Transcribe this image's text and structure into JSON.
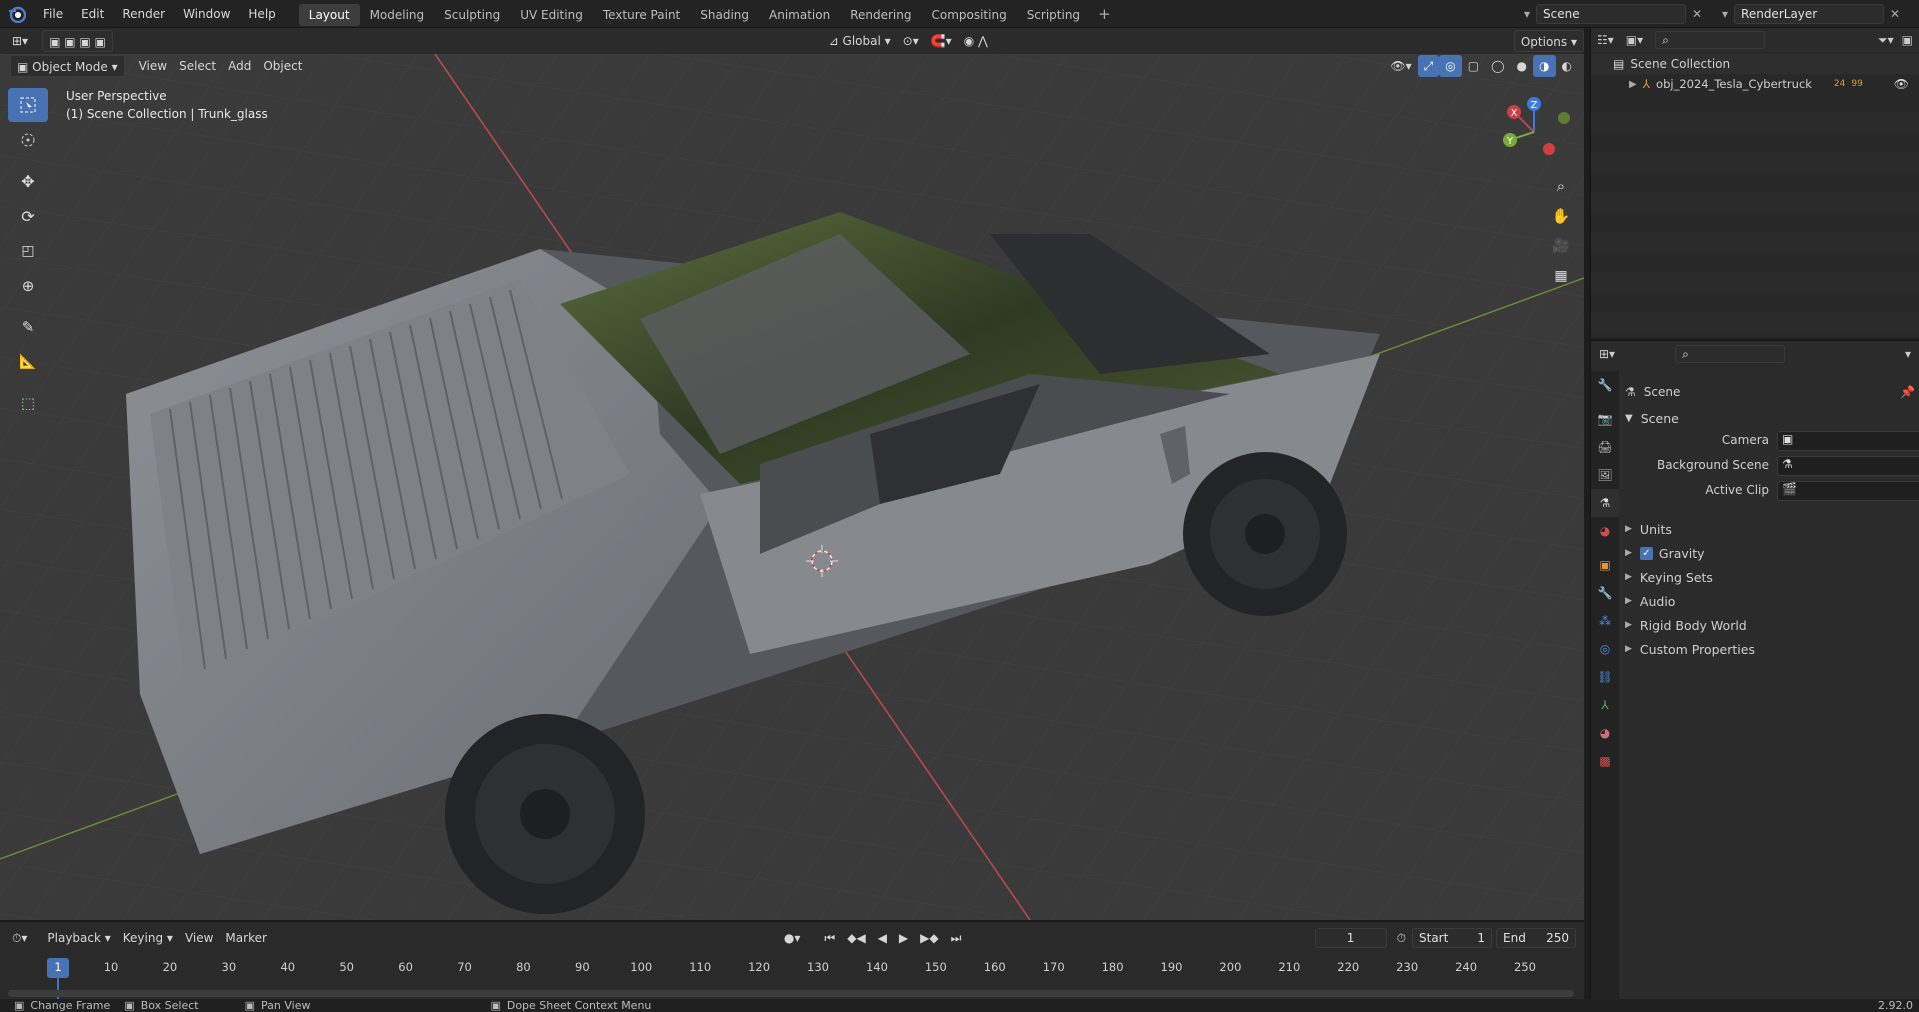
{
  "top_menu": [
    "File",
    "Edit",
    "Render",
    "Window",
    "Help"
  ],
  "workspaces": [
    {
      "label": "Layout",
      "active": true
    },
    {
      "label": "Modeling"
    },
    {
      "label": "Sculpting"
    },
    {
      "label": "UV Editing"
    },
    {
      "label": "Texture Paint"
    },
    {
      "label": "Shading"
    },
    {
      "label": "Animation"
    },
    {
      "label": "Rendering"
    },
    {
      "label": "Compositing"
    },
    {
      "label": "Scripting"
    }
  ],
  "scene_field": "Scene",
  "renderlayer_field": "RenderLayer",
  "vp_header": {
    "mode": "Object Mode",
    "menus": [
      "View",
      "Select",
      "Add",
      "Object"
    ],
    "transform_orientation": "Global",
    "options": "Options"
  },
  "overlay_text": {
    "line1": "User Perspective",
    "line2": "(1) Scene Collection | Trunk_glass"
  },
  "gizmo_axes": {
    "x": "X",
    "y": "Y",
    "z": "Z"
  },
  "outliner": {
    "root": "Scene Collection",
    "item": "obj_2024_Tesla_Cybertruck",
    "badge": "24",
    "badge2": "99"
  },
  "props": {
    "header": "Scene",
    "panel": "Scene",
    "camera_label": "Camera",
    "bg_label": "Background Scene",
    "clip_label": "Active Clip",
    "sections": [
      "Units",
      "Gravity",
      "Keying Sets",
      "Audio",
      "Rigid Body World",
      "Custom Properties"
    ]
  },
  "timeline": {
    "menus": [
      "Playback",
      "Keying",
      "View",
      "Marker"
    ],
    "current_frame": "1",
    "start_label": "Start",
    "start": "1",
    "end_label": "End",
    "end": "250",
    "ticks": [
      "1",
      "10",
      "20",
      "30",
      "40",
      "50",
      "60",
      "70",
      "80",
      "90",
      "100",
      "110",
      "120",
      "130",
      "140",
      "150",
      "160",
      "170",
      "180",
      "190",
      "200",
      "210",
      "220",
      "230",
      "240",
      "250"
    ]
  },
  "status": {
    "left": "Change Frame",
    "box": "Box Select",
    "pan": "Pan View",
    "ctx": "Dope Sheet Context Menu",
    "version": "2.92.0"
  },
  "colors": {
    "accent": "#4772b3",
    "x_axis": "#c7404a",
    "y_axis": "#7aab3a",
    "z_axis": "#3d7bd8"
  }
}
